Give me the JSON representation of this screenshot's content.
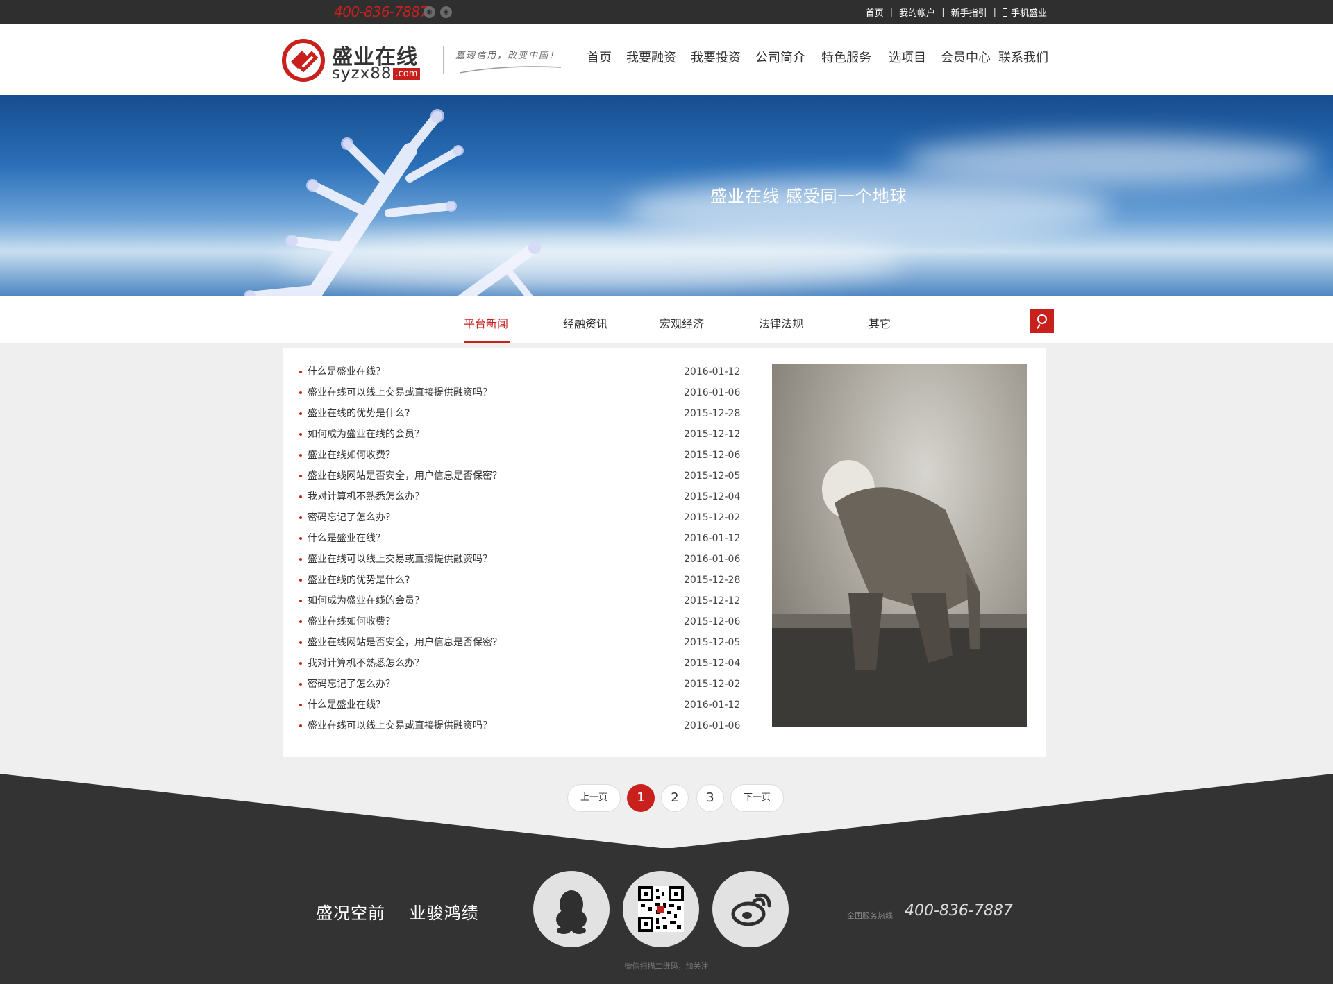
{
  "topbar": {
    "phone": "400-836-7887",
    "links": [
      "首页",
      "我的帐户",
      "新手指引",
      "手机盛业"
    ]
  },
  "header": {
    "logo_cn": "盛业在线",
    "logo_en": "syzx88",
    "logo_domain": ".com",
    "slogan": "嘉璁信用，改变中国！",
    "nav": [
      "首页",
      "我要融资",
      "我要投资",
      "公司简介",
      "特色服务",
      "选项目",
      "会员中心",
      "联系我们"
    ]
  },
  "banner": {
    "text": "盛业在线  感受同一个地球"
  },
  "tabs": [
    "平台新闻",
    "经融资讯",
    "宏观经济",
    "法律法规",
    "其它"
  ],
  "news": [
    {
      "title": "什么是盛业在线？",
      "date": "2016-01-12"
    },
    {
      "title": "盛业在线可以线上交易或直接提供融资吗？",
      "date": "2016-01-06"
    },
    {
      "title": "盛业在线的优势是什么?",
      "date": "2015-12-28"
    },
    {
      "title": "如何成为盛业在线的会员？",
      "date": "2015-12-12"
    },
    {
      "title": "盛业在线如何收费？",
      "date": "2015-12-06"
    },
    {
      "title": "盛业在线网站是否安全，用户信息是否保密？",
      "date": "2015-12-05"
    },
    {
      "title": "我对计算机不熟悉怎么办？",
      "date": "2015-12-04"
    },
    {
      "title": "密码忘记了怎么办？",
      "date": "2015-12-02"
    },
    {
      "title": "什么是盛业在线？",
      "date": "2016-01-12"
    },
    {
      "title": "盛业在线可以线上交易或直接提供融资吗？",
      "date": "2016-01-06"
    },
    {
      "title": "盛业在线的优势是什么?",
      "date": "2015-12-28"
    },
    {
      "title": "如何成为盛业在线的会员？",
      "date": "2015-12-12"
    },
    {
      "title": "盛业在线如何收费？",
      "date": "2015-12-06"
    },
    {
      "title": "盛业在线网站是否安全，用户信息是否保密？",
      "date": "2015-12-05"
    },
    {
      "title": "我对计算机不熟悉怎么办？",
      "date": "2015-12-04"
    },
    {
      "title": "密码忘记了怎么办？",
      "date": "2015-12-02"
    },
    {
      "title": "什么是盛业在线？",
      "date": "2016-01-12"
    },
    {
      "title": "盛业在线可以线上交易或直接提供融资吗？",
      "date": "2016-01-06"
    }
  ],
  "pager": {
    "prev": "上一页",
    "pages": [
      "1",
      "2",
      "3"
    ],
    "current": "1",
    "next": "下一页"
  },
  "footer": {
    "motto": "盛况空前    业骏鸿绩",
    "hotline_label": "全国服务热线",
    "hotline": "400-836-7887",
    "qr_caption": "微信扫描二维码，加关注"
  },
  "colors": {
    "accent": "#c8201d",
    "topbar_bg": "#2f2f2f",
    "footer_bg": "#333333"
  },
  "icons": [
    "qq-icon",
    "wechat-qr-icon",
    "weibo-icon",
    "search-icon",
    "mobile-icon"
  ]
}
